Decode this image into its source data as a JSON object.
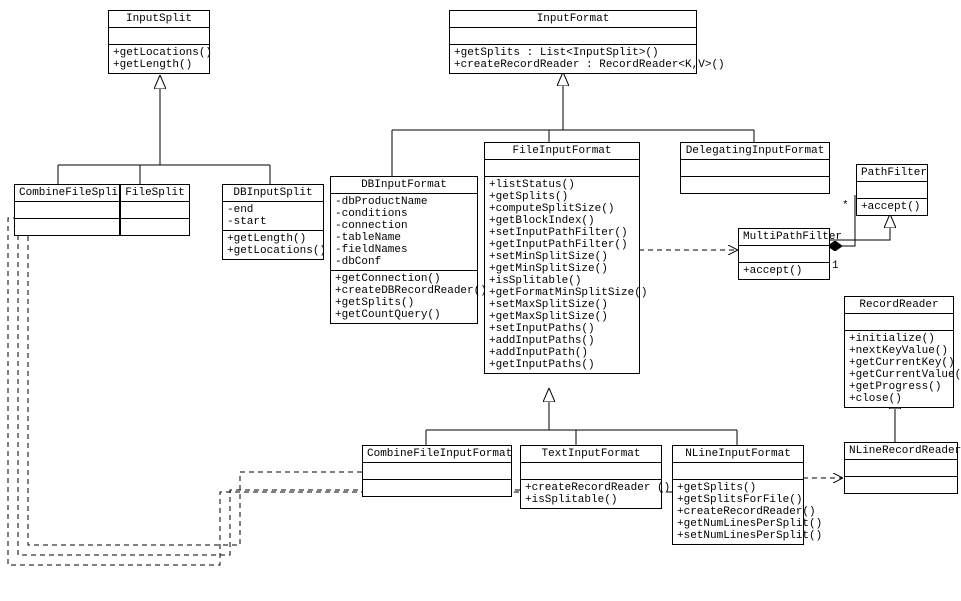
{
  "classes": {
    "InputSplit": {
      "name": "InputSplit",
      "methods": [
        "+getLocations()",
        "+getLength()"
      ]
    },
    "InputFormat": {
      "name": "InputFormat",
      "methods": [
        "+getSplits : List<InputSplit>()",
        "+createRecordReader : RecordReader<K,V>()"
      ]
    },
    "CombineFileSplit": {
      "name": "CombineFileSplit"
    },
    "FileSplit": {
      "name": "FileSplit"
    },
    "DBInputSplit": {
      "name": "DBInputSplit",
      "attrs": [
        "-end",
        "-start"
      ],
      "methods": [
        "+getLength()",
        "+getLocations()"
      ]
    },
    "DBInputFormat": {
      "name": "DBInputFormat",
      "attrs": [
        "-dbProductName",
        "-conditions",
        "-connection",
        "-tableName",
        "-fieldNames",
        "-dbConf"
      ],
      "methods": [
        "+getConnection()",
        "+createDBRecordReader()",
        "+getSplits()",
        "+getCountQuery()"
      ]
    },
    "FileInputFormat": {
      "name": "FileInputFormat",
      "methods": [
        "+listStatus()",
        "+getSplits()",
        "+computeSplitSize()",
        "+getBlockIndex()",
        "+setInputPathFilter()",
        "+getInputPathFilter()",
        "+setMinSplitSize()",
        "+getMinSplitSize()",
        "+isSplitable()",
        "+getFormatMinSplitSize()",
        "+setMaxSplitSize()",
        "+getMaxSplitSize()",
        "+setInputPaths()",
        "+addInputPaths()",
        "+addInputPath()",
        "+getInputPaths()"
      ]
    },
    "DelegatingInputFormat": {
      "name": "DelegatingInputFormat"
    },
    "MultiPathFilter": {
      "name": "MultiPathFilter",
      "methods": [
        "+accept()"
      ]
    },
    "PathFilter": {
      "name": "PathFilter",
      "methods": [
        "+accept()"
      ]
    },
    "RecordReader": {
      "name": "RecordReader",
      "methods": [
        "+initialize()",
        "+nextKeyValue()",
        "+getCurrentKey()",
        "+getCurrentValue()",
        "+getProgress()",
        "+close()"
      ]
    },
    "CombineFileInputFormat": {
      "name": "CombineFileInputFormat"
    },
    "TextInputFormat": {
      "name": "TextInputFormat",
      "methods": [
        "+createRecordReader ()",
        "+isSplitable()"
      ]
    },
    "NLineInputFormat": {
      "name": "NLineInputFormat",
      "methods": [
        "+getSplits()",
        "+getSplitsForFile()",
        "+createRecordReader()",
        "+getNumLinesPerSplit()",
        "+setNumLinesPerSplit()"
      ]
    },
    "NLineRecordReader": {
      "name": "NLineRecordReader"
    }
  },
  "mult": {
    "star": "*",
    "one": "1"
  }
}
